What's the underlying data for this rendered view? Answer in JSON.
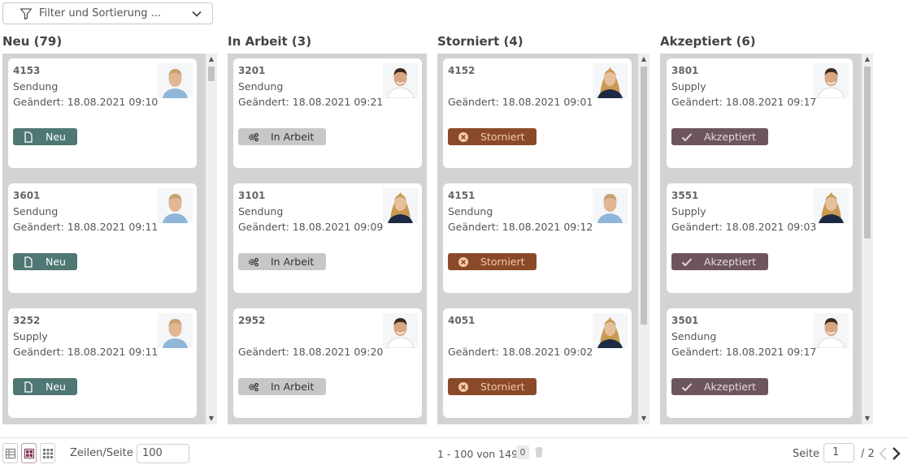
{
  "filter": {
    "label": "Filter und Sortierung ..."
  },
  "columns": [
    {
      "title": "Neu (79)",
      "cards": [
        {
          "id": "4153",
          "type": "Sendung",
          "changed": "Geändert: 18.08.2021 09:10",
          "status": "Neu",
          "avatar": "man"
        },
        {
          "id": "3601",
          "type": "Sendung",
          "changed": "Geändert: 18.08.2021 09:11",
          "status": "Neu",
          "avatar": "man"
        },
        {
          "id": "3252",
          "type": "Supply",
          "changed": "Geändert: 18.08.2021 09:11",
          "status": "Neu",
          "avatar": "man"
        }
      ]
    },
    {
      "title": "In Arbeit (3)",
      "cards": [
        {
          "id": "3201",
          "type": "Sendung",
          "changed": "Geändert: 18.08.2021 09:21",
          "status": "In Arbeit",
          "avatar": "man2"
        },
        {
          "id": "3101",
          "type": "Sendung",
          "changed": "Geändert: 18.08.2021 09:09",
          "status": "In Arbeit",
          "avatar": "woman"
        },
        {
          "id": "2952",
          "type": "",
          "changed": "Geändert: 18.08.2021 09:20",
          "status": "In Arbeit",
          "avatar": "man2"
        }
      ]
    },
    {
      "title": "Storniert (4)",
      "cards": [
        {
          "id": "4152",
          "type": "",
          "changed": "Geändert: 18.08.2021 09:01",
          "status": "Storniert",
          "avatar": "woman"
        },
        {
          "id": "4151",
          "type": "Sendung",
          "changed": "Geändert: 18.08.2021 09:12",
          "status": "Storniert",
          "avatar": "man"
        },
        {
          "id": "4051",
          "type": "",
          "changed": "Geändert: 18.08.2021 09:02",
          "status": "Storniert",
          "avatar": "woman"
        }
      ]
    },
    {
      "title": "Akzeptiert (6)",
      "cards": [
        {
          "id": "3801",
          "type": "Supply",
          "changed": "Geändert: 18.08.2021 09:17",
          "status": "Akzeptiert",
          "avatar": "man2"
        },
        {
          "id": "3551",
          "type": "Supply",
          "changed": "Geändert: 18.08.2021 09:03",
          "status": "Akzeptiert",
          "avatar": "woman"
        },
        {
          "id": "3501",
          "type": "Sendung",
          "changed": "Geändert: 18.08.2021 09:17",
          "status": "Akzeptiert",
          "avatar": "man2"
        }
      ]
    }
  ],
  "footer": {
    "rows_label": "Zeilen/Seite",
    "rows_value": "100",
    "range": "1 - 100 von 149",
    "selected_count": "0",
    "page_label": "Seite",
    "page_value": "1",
    "page_total": "/ 2"
  },
  "colors": {
    "neu": "#4f7773",
    "in_arbeit": "#c7c7c7",
    "storniert": "#8a4a2a",
    "akzeptiert": "#6d5560",
    "lane_bg": "#d3d3d3"
  }
}
